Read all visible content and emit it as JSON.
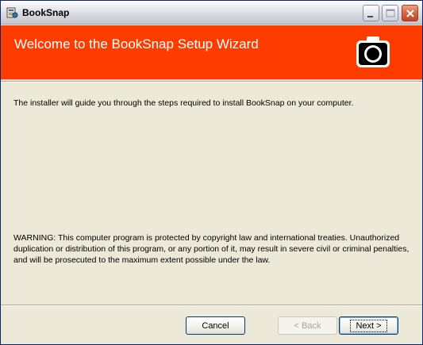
{
  "window": {
    "title": "BookSnap"
  },
  "banner": {
    "title": "Welcome to the BookSnap Setup Wizard",
    "background": "#ff3c00",
    "icon": "camera-icon"
  },
  "body": {
    "intro": "The installer will guide you through the steps required to install BookSnap on your computer.",
    "warning": "WARNING: This computer program is protected by copyright law and international treaties. Unauthorized duplication or distribution of this program, or any portion of it, may result in severe civil or criminal penalties, and will be prosecuted to the maximum extent possible under the law."
  },
  "buttons": {
    "cancel": "Cancel",
    "back": "< Back",
    "next": "Next >"
  },
  "titlebar_icons": [
    "app-icon",
    "minimize-icon",
    "maximize-icon",
    "close-icon"
  ]
}
